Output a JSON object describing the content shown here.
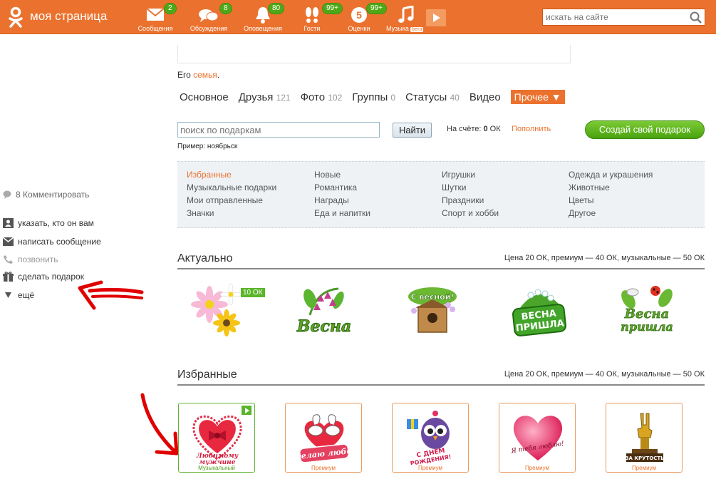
{
  "header": {
    "site_title": "моя страница",
    "search_placeholder": "искать на сайте",
    "nav": [
      {
        "label": "Сообщения",
        "badge": "2",
        "icon": "envelope-icon"
      },
      {
        "label": "Обсуждения",
        "badge": "8",
        "icon": "chat-bubbles-icon"
      },
      {
        "label": "Оповещения",
        "badge": "80",
        "icon": "bell-icon"
      },
      {
        "label": "Гости",
        "badge": "99+",
        "icon": "footprints-icon"
      },
      {
        "label": "Оценки",
        "badge": "99+",
        "icon": "rating-five-icon",
        "digit": "5"
      },
      {
        "label": "Музыка",
        "badge": "",
        "icon": "music-note-icon",
        "beta": "бета"
      }
    ]
  },
  "left": {
    "comment": "8 Комментировать",
    "links": [
      {
        "label": "указать, кто он вам",
        "icon": "person-icon",
        "muted": false
      },
      {
        "label": "написать сообщение",
        "icon": "envelope-icon",
        "muted": false
      },
      {
        "label": "позвонить",
        "icon": "phone-icon",
        "muted": true
      },
      {
        "label": "сделать подарок",
        "icon": "gift-icon",
        "muted": false
      },
      {
        "label": "ещё",
        "icon": "triangle-down-icon",
        "muted": false
      }
    ]
  },
  "profile": {
    "family_prefix": "Его ",
    "family_link": "семья",
    "family_suffix": "."
  },
  "tabs": [
    {
      "label": "Основное",
      "count": ""
    },
    {
      "label": "Друзья",
      "count": "121"
    },
    {
      "label": "Фото",
      "count": "102"
    },
    {
      "label": "Группы",
      "count": "0"
    },
    {
      "label": "Статусы",
      "count": "40"
    },
    {
      "label": "Видео",
      "count": ""
    }
  ],
  "tab_more": "Прочее ▼",
  "gift_search": {
    "placeholder": "поиск по подаркам",
    "button": "Найти",
    "account_prefix": "На счёте: ",
    "account_value": "0",
    "account_unit": " ОК",
    "topup": "Пополнить",
    "create": "Создай свой подарок",
    "example_prefix": "Пример: ",
    "example_value": "ноябрьск"
  },
  "categories": [
    [
      "Избранные",
      "Музыкальные подарки",
      "Мои отправленные",
      "Значки"
    ],
    [
      "Новые",
      "Романтика",
      "Награды",
      "Еда и напитки"
    ],
    [
      "Игрушки",
      "Шутки",
      "Праздники",
      "Спорт и хобби"
    ],
    [
      "Одежда и украшения",
      "Животные",
      "Цветы",
      "Другое"
    ]
  ],
  "sections": {
    "actual": {
      "title": "Актуально",
      "price": "Цена 20 ОК, премиум — 40 ОК, музыкальные — 50 ОК",
      "price_tag": "10 ОК",
      "gifts": [
        "flowers-bouquet-image",
        "vesna-bluebells-image",
        "s-vesnoy-birdhouse-image",
        "vesna-prishla-lily-image",
        "vesna-prishla-ladybug-image"
      ]
    },
    "favorites": {
      "title": "Избранные",
      "price": "Цена 20 ОК, премиум — 40 ОК, музыкальные — 50 ОК",
      "cards": [
        {
          "caption": "Музыкальный",
          "image": "lyubimomu-muzhchine-heart-image",
          "music": true
        },
        {
          "caption": "Премиум",
          "image": "zhelayu-lyubvi-swans-image",
          "music": false
        },
        {
          "caption": "Премиум",
          "image": "s-dnem-rozhdeniya-owl-image",
          "music": false
        },
        {
          "caption": "Премиум",
          "image": "ya-tebya-lyublyu-heart-image",
          "music": false
        },
        {
          "caption": "Премиум",
          "image": "za-krutost-trophy-image",
          "music": false
        }
      ]
    }
  },
  "colors": {
    "brand": "#eb722e",
    "badge": "#50a818",
    "annotation_arrow": "#e00000"
  }
}
